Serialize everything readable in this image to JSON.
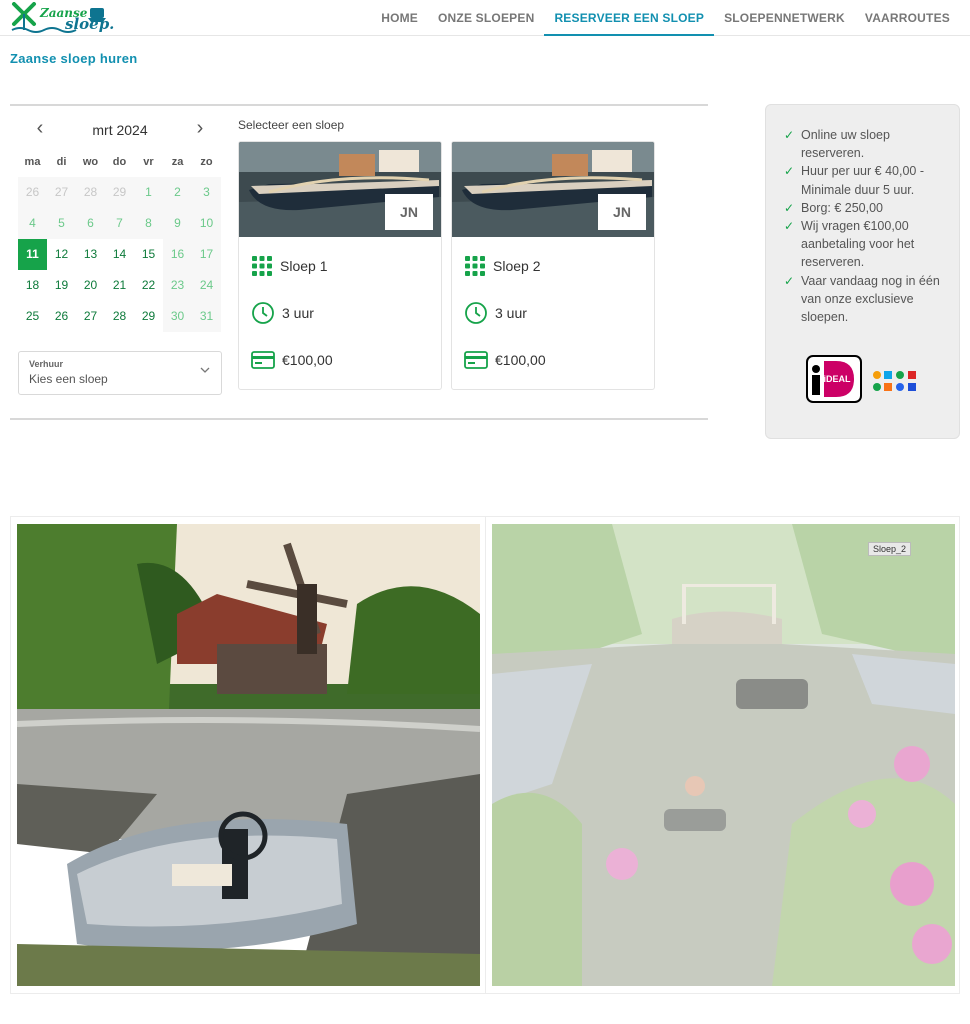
{
  "brand": {
    "logo_text_1": "Zaanse",
    "logo_text_2": "sloep."
  },
  "nav": {
    "items": [
      "HOME",
      "ONZE SLOEPEN",
      "RESERVEER EEN SLOEP",
      "SLOEPENNETWERK",
      "VAARROUTES"
    ],
    "active_index": 2
  },
  "page": {
    "title": "Zaanse sloep huren"
  },
  "calendar": {
    "month_label": "mrt 2024",
    "prev": "‹",
    "next": "›",
    "weekdays": [
      "ma",
      "di",
      "wo",
      "do",
      "vr",
      "za",
      "zo"
    ],
    "days": [
      {
        "d": "26",
        "s": "out"
      },
      {
        "d": "27",
        "s": "out"
      },
      {
        "d": "28",
        "s": "out"
      },
      {
        "d": "29",
        "s": "out"
      },
      {
        "d": "1",
        "s": "past"
      },
      {
        "d": "2",
        "s": "past"
      },
      {
        "d": "3",
        "s": "past"
      },
      {
        "d": "4",
        "s": "past"
      },
      {
        "d": "5",
        "s": "past"
      },
      {
        "d": "6",
        "s": "past"
      },
      {
        "d": "7",
        "s": "past"
      },
      {
        "d": "8",
        "s": "past"
      },
      {
        "d": "9",
        "s": "past"
      },
      {
        "d": "10",
        "s": "past"
      },
      {
        "d": "11",
        "s": "sel"
      },
      {
        "d": "12",
        "s": "avail"
      },
      {
        "d": "13",
        "s": "avail"
      },
      {
        "d": "14",
        "s": "avail"
      },
      {
        "d": "15",
        "s": "avail"
      },
      {
        "d": "16",
        "s": "weekend"
      },
      {
        "d": "17",
        "s": "weekend"
      },
      {
        "d": "18",
        "s": "avail"
      },
      {
        "d": "19",
        "s": "avail"
      },
      {
        "d": "20",
        "s": "avail"
      },
      {
        "d": "21",
        "s": "avail"
      },
      {
        "d": "22",
        "s": "avail"
      },
      {
        "d": "23",
        "s": "weekend"
      },
      {
        "d": "24",
        "s": "weekend"
      },
      {
        "d": "25",
        "s": "avail"
      },
      {
        "d": "26",
        "s": "avail"
      },
      {
        "d": "27",
        "s": "avail"
      },
      {
        "d": "28",
        "s": "avail"
      },
      {
        "d": "29",
        "s": "avail"
      },
      {
        "d": "30",
        "s": "weekend"
      },
      {
        "d": "31",
        "s": "weekend"
      }
    ]
  },
  "rental_select": {
    "label": "Verhuur",
    "value": "Kies een sloep"
  },
  "boats": {
    "heading": "Selecteer een sloep",
    "items": [
      {
        "badge": "JN",
        "name": "Sloep 1",
        "duration": "3 uur",
        "price": "€100,00"
      },
      {
        "badge": "JN",
        "name": "Sloep 2",
        "duration": "3 uur",
        "price": "€100,00"
      }
    ]
  },
  "info": {
    "points": [
      "Online uw sloep reserveren.",
      "Huur per uur € 40,00 - Minimale duur 5 uur.",
      "Borg: € 250,00",
      "Wij vragen €100,00 aanbetaling voor het reserveren.",
      "Vaar vandaag nog in één van onze exclusieve sloepen."
    ],
    "check_glyph": "✓",
    "ideal_logo_text": "iDEAL"
  },
  "gallery": {
    "tag": "Sloep_2"
  },
  "colors": {
    "accent": "#1290b0",
    "green": "#16a34a"
  }
}
